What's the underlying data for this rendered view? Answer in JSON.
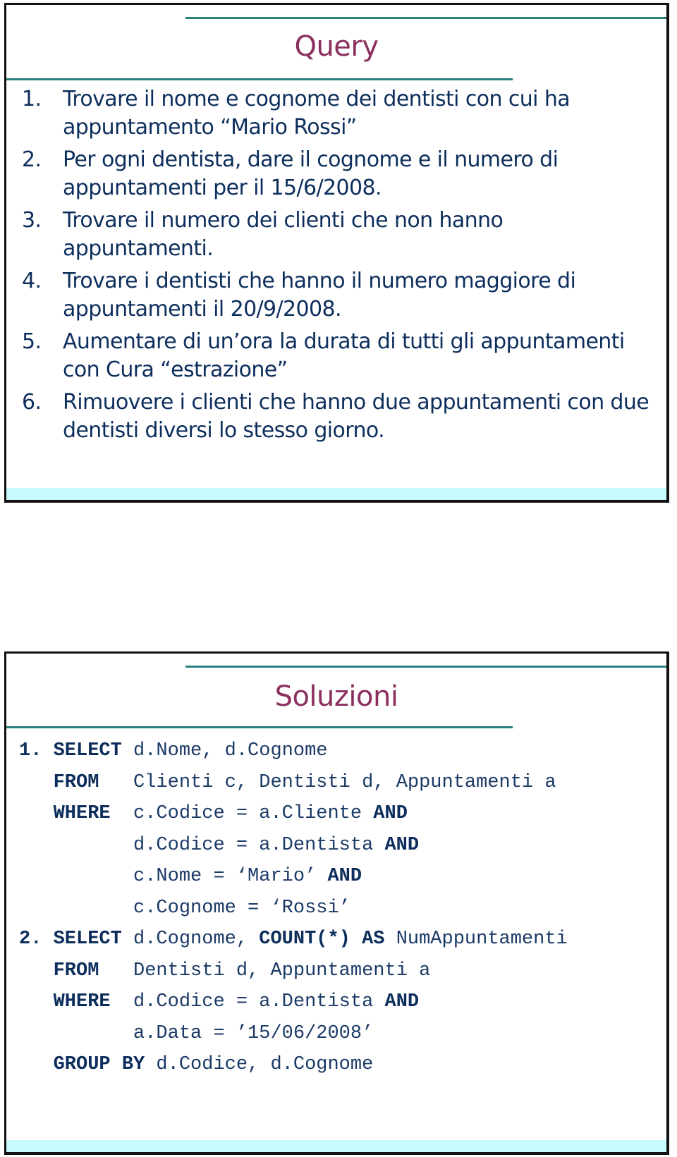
{
  "slides": [
    {
      "title": "Query",
      "items": [
        {
          "num": "1.",
          "text": "Trovare il nome e cognome dei dentisti con cui ha appuntamento “Mario Rossi”"
        },
        {
          "num": "2.",
          "text": "Per ogni dentista, dare il cognome e il numero di appuntamenti per il 15/6/2008."
        },
        {
          "num": "3.",
          "text": "Trovare il numero dei clienti che non hanno appuntamenti."
        },
        {
          "num": "4.",
          "text": "Trovare i dentisti che hanno il numero maggiore di appuntamenti il 20/9/2008."
        },
        {
          "num": "5.",
          "text": "Aumentare di un’ora la durata di tutti gli appuntamenti con Cura “estrazione”"
        },
        {
          "num": "6.",
          "text": "Rimuovere i clienti che hanno due appuntamenti con due dentisti diversi lo stesso giorno."
        }
      ]
    },
    {
      "title": "Soluzioni",
      "code_lines": [
        [
          {
            "t": "1. ",
            "k": true
          },
          {
            "t": "SELECT",
            "k": true
          },
          {
            "t": " d.Nome, d.Cognome",
            "k": false
          }
        ],
        [
          {
            "t": "   ",
            "k": false
          },
          {
            "t": "FROM",
            "k": true
          },
          {
            "t": "   Clienti c, Dentisti d, Appuntamenti a",
            "k": false
          }
        ],
        [
          {
            "t": "   ",
            "k": false
          },
          {
            "t": "WHERE",
            "k": true
          },
          {
            "t": "  c.Codice = a.Cliente ",
            "k": false
          },
          {
            "t": "AND",
            "k": true
          }
        ],
        [
          {
            "t": "          d.Codice = a.Dentista ",
            "k": false
          },
          {
            "t": "AND",
            "k": true
          }
        ],
        [
          {
            "t": "          c.Nome = ‘Mario’ ",
            "k": false
          },
          {
            "t": "AND",
            "k": true
          }
        ],
        [
          {
            "t": "          c.Cognome = ‘Rossi’",
            "k": false
          }
        ],
        [
          {
            "t": "2. ",
            "k": true
          },
          {
            "t": "SELECT",
            "k": true
          },
          {
            "t": " d.Cognome, ",
            "k": false
          },
          {
            "t": "COUNT(*)",
            "k": true
          },
          {
            "t": " ",
            "k": false
          },
          {
            "t": "AS",
            "k": true
          },
          {
            "t": " NumAppuntamenti",
            "k": false
          }
        ],
        [
          {
            "t": "   ",
            "k": false
          },
          {
            "t": "FROM",
            "k": true
          },
          {
            "t": "   Dentisti d, Appuntamenti a",
            "k": false
          }
        ],
        [
          {
            "t": "   ",
            "k": false
          },
          {
            "t": "WHERE",
            "k": true
          },
          {
            "t": "  d.Codice = a.Dentista ",
            "k": false
          },
          {
            "t": "AND",
            "k": true
          }
        ],
        [
          {
            "t": "          a.Data = ’15/06/2008’",
            "k": false
          }
        ],
        [
          {
            "t": "   ",
            "k": false
          },
          {
            "t": "GROUP BY",
            "k": true
          },
          {
            "t": " d.Codice, d.Cognome",
            "k": false
          }
        ]
      ]
    }
  ]
}
